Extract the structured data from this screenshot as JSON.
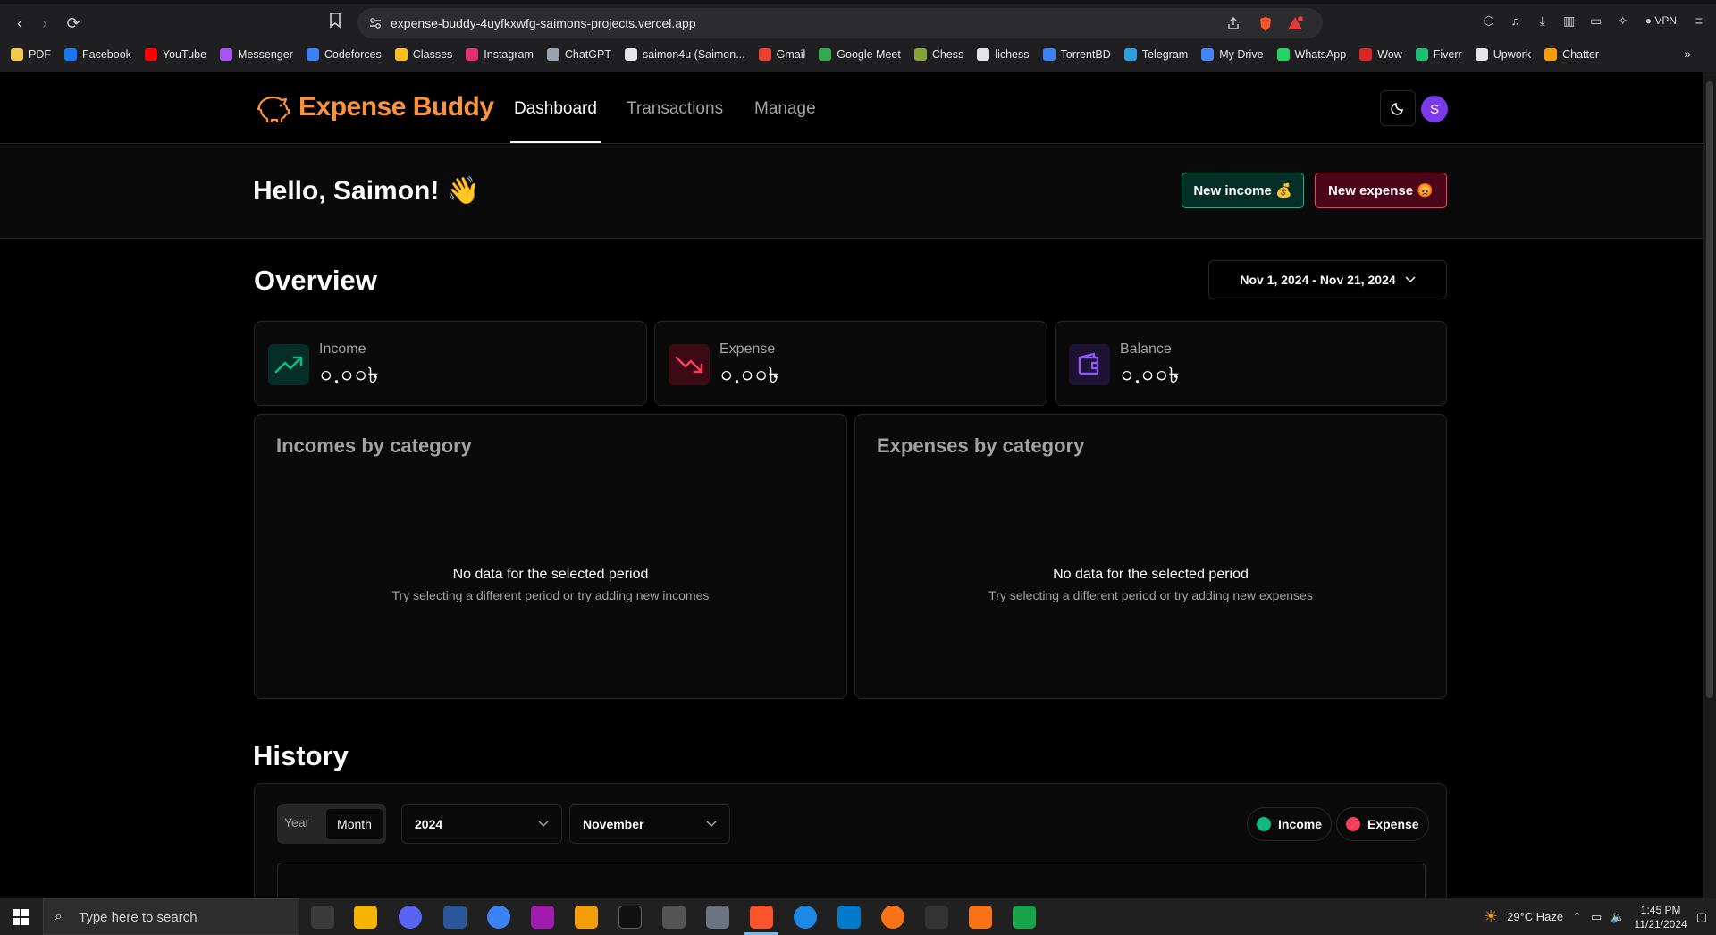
{
  "browser": {
    "url": "expense-buddy-4uyfkxwfg-saimons-projects.vercel.app",
    "vpn_label": "VPN",
    "bookmarks": [
      "PDF",
      "Facebook",
      "YouTube",
      "Messenger",
      "Codeforces",
      "Classes",
      "Instagram",
      "ChatGPT",
      "saimon4u (Saimon...",
      "Gmail",
      "Google Meet",
      "Chess",
      "lichess",
      "TorrentBD",
      "Telegram",
      "My Drive",
      "WhatsApp",
      "Wow",
      "Fiverr",
      "Upwork",
      "Chatter"
    ],
    "bookmark_colors": [
      "#f2c94c",
      "#1877f2",
      "#ff0000",
      "#a855f7",
      "#3b82f6",
      "#fbbf24",
      "#e1306c",
      "#9ca3af",
      "#e5e5e5",
      "#ea4335",
      "#34a853",
      "#86a33b",
      "#e5e5e5",
      "#3b82f6",
      "#2aa1da",
      "#4285f4",
      "#25d366",
      "#dc2626",
      "#1dbf73",
      "#e5e5e5",
      "#f59e0b"
    ]
  },
  "app": {
    "brand": "Expense Buddy",
    "nav": [
      "Dashboard",
      "Transactions",
      "Manage"
    ],
    "active_nav": "Dashboard",
    "avatar_letter": "S",
    "greeting": "Hello, Saimon! 👋",
    "new_income_label": "New income 💰",
    "new_expense_label": "New expense 😡",
    "overview_title": "Overview",
    "date_range": "Nov 1, 2024 - Nov 21, 2024",
    "stats": {
      "income_label": "Income",
      "income_value": "০.০০৳",
      "expense_label": "Expense",
      "expense_value": "০.০০৳",
      "balance_label": "Balance",
      "balance_value": "০.০০৳"
    },
    "incomes_title": "Incomes by category",
    "expenses_title": "Expenses by category",
    "empty_title": "No data for the selected period",
    "empty_incomes_sub": "Try selecting a different period or try adding new incomes",
    "empty_expenses_sub": "Try selecting a different period or try adding new expenses",
    "history_title": "History",
    "history_year_tab": "Year",
    "history_month_tab": "Month",
    "history_year_value": "2024",
    "history_month_value": "November",
    "legend_income": "Income",
    "legend_expense": "Expense",
    "colors": {
      "brand": "#fb923c",
      "income": "#10b981",
      "expense": "#f43f5e",
      "balance": "#8b5cf6"
    }
  },
  "taskbar": {
    "search_placeholder": "Type here to search",
    "weather": "29°C  Haze",
    "time": "1:45 PM",
    "date": "11/21/2024"
  }
}
